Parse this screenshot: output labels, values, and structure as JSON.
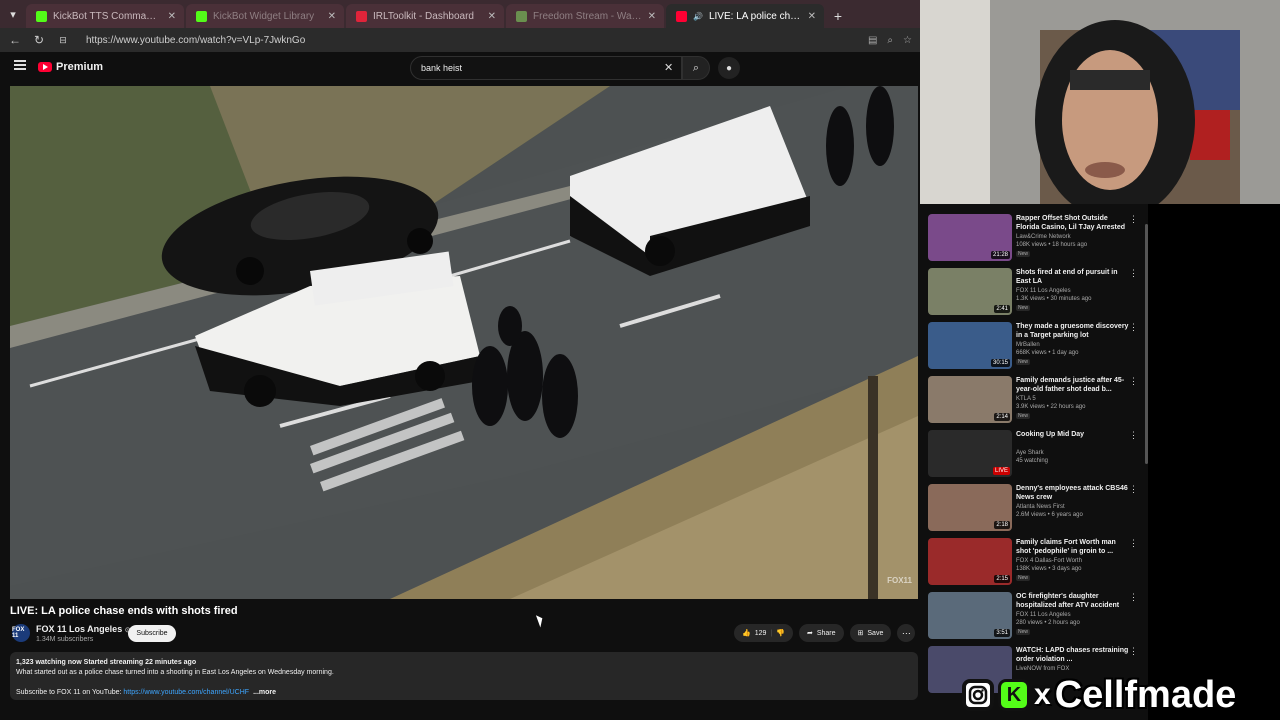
{
  "browser": {
    "tabs": [
      {
        "label": "KickBot TTS Commands",
        "color": "#53fc18",
        "style": "normal"
      },
      {
        "label": "KickBot Widget Library",
        "color": "#53fc18",
        "style": "dim"
      },
      {
        "label": "IRLToolkit - Dashboard",
        "color": "#e0243a",
        "style": "normal"
      },
      {
        "label": "Freedom Stream - Watch Live",
        "color": "#6a8f4f",
        "style": "dim"
      },
      {
        "label": "LIVE: LA police chase ends with",
        "color": "#ff0033",
        "style": "active"
      }
    ],
    "url": "https://www.youtube.com/watch?v=VLp-7JwknGo"
  },
  "youtube": {
    "logo_label": "Premium",
    "search_value": "bank heist",
    "video_watermark": "FOX11",
    "video_title": "LIVE: LA police chase ends with shots fired",
    "channel": {
      "avatar_text": "FOX 11",
      "name": "FOX 11 Los Angeles",
      "subscribers": "1.34M subscribers",
      "subscribe_label": "Subscribe"
    },
    "actions": {
      "like_count": "129",
      "share_label": "Share",
      "save_label": "Save"
    },
    "description": {
      "stats": "1,323 watching now  Started streaming 22 minutes ago",
      "line1": "What started out as a police chase turned into a shooting in East Los Angeles on Wednesday morning.",
      "line2_prefix": "Subscribe to FOX 11 on YouTube: ",
      "line2_link": "https://www.youtube.com/channel/UCHF",
      "more_label": "...more"
    }
  },
  "sidebar": {
    "items": [
      {
        "title": "Rapper Offset Shot Outside Florida Casino, Lil TJay Arrested",
        "channel": "Law&Crime Network",
        "meta": "108K views • 18 hours ago",
        "badge": "New",
        "duration": "21:28",
        "thumb": "#7a4a8a"
      },
      {
        "title": "Shots fired at end of pursuit in East LA",
        "channel": "FOX 11 Los Angeles",
        "meta": "1.3K views • 30 minutes ago",
        "badge": "New",
        "duration": "2:41",
        "thumb": "#7a8066"
      },
      {
        "title": "They made a gruesome discovery in a Target parking lot",
        "channel": "MrBallen",
        "meta": "668K views • 1 day ago",
        "badge": "New",
        "duration": "30:15",
        "thumb": "#3a5c8a"
      },
      {
        "title": "Family demands justice after 45-year-old father shot dead b...",
        "channel": "KTLA 5",
        "meta": "3.9K views • 22 hours ago",
        "badge": "New",
        "duration": "2:14",
        "thumb": "#8a7a6a"
      },
      {
        "title": "Cooking Up Mid Day",
        "channel": "Aye Shark",
        "meta": "45 watching",
        "badge": "",
        "duration": "LIVE",
        "thumb": "#2a2a2a"
      },
      {
        "title": "Denny's employees attack CBS46 News crew",
        "channel": "Atlanta News First",
        "meta": "2.6M views • 6 years ago",
        "badge": "",
        "duration": "2:18",
        "thumb": "#8a6a5a"
      },
      {
        "title": "Family claims Fort Worth man shot 'pedophile' in groin to ...",
        "channel": "FOX 4 Dallas-Fort Worth",
        "meta": "138K views • 3 days ago",
        "badge": "New",
        "duration": "2:15",
        "thumb": "#9a2a2a"
      },
      {
        "title": "OC firefighter's daughter hospitalized after ATV accident",
        "channel": "FOX 11 Los Angeles",
        "meta": "280 views • 2 hours ago",
        "badge": "New",
        "duration": "3:51",
        "thumb": "#5a6a7a"
      },
      {
        "title": "WATCH: LAPD chases restraining order violation ...",
        "channel": "LiveNOW from FOX",
        "meta": "",
        "badge": "",
        "duration": "",
        "thumb": "#4a4a6a"
      }
    ]
  },
  "overlay": {
    "x_glyph": "x",
    "handle": "Cellfmade",
    "ig_icon": "instagram-icon",
    "kick_icon": "kick-icon",
    "kick_letter": "K"
  }
}
